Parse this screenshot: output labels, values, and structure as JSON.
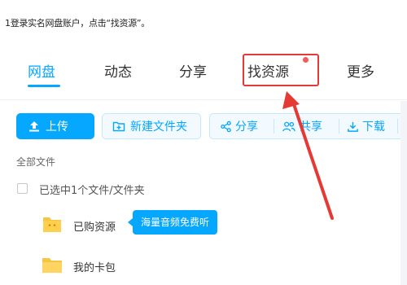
{
  "instruction": "1登录实名网盘账户，点击“找资源”。",
  "tabs": [
    {
      "label": "网盘"
    },
    {
      "label": "动态"
    },
    {
      "label": "分享"
    },
    {
      "label": "找资源"
    },
    {
      "label": "更多"
    }
  ],
  "toolbar": {
    "upload": "上传",
    "new_folder": "新建文件夹",
    "share": "分享",
    "shared": "共享",
    "download": "下载"
  },
  "breadcrumb": "全部文件",
  "selection": "已选中1个文件/文件夹",
  "files": [
    {
      "name": "已购资源"
    },
    {
      "name": "我的卡包"
    }
  ],
  "tooltip": "海量音频免费听",
  "colors": {
    "accent": "#06a7ff",
    "highlight": "#e53935",
    "folder": "#f6c542"
  }
}
